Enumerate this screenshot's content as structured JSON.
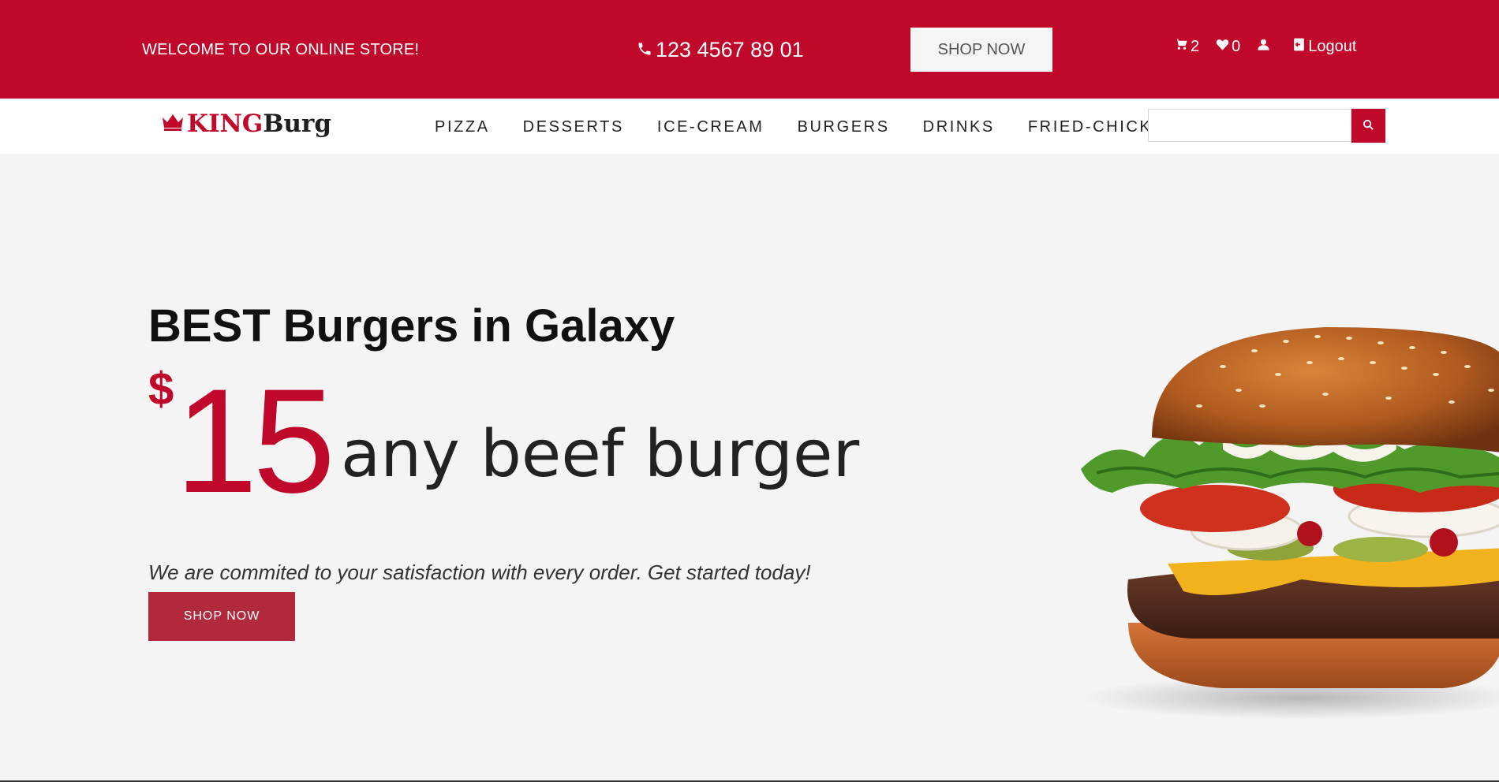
{
  "topbar": {
    "welcome": "WELCOME TO OUR ONLINE STORE!",
    "phone": "123 4567 89 01",
    "shop_now": "SHOP NOW",
    "cart_count": "2",
    "wishlist_count": "0",
    "logout": "Logout"
  },
  "brand": {
    "name_part1": "KING",
    "name_part2": "Burg"
  },
  "nav": {
    "items": [
      "PIZZA",
      "DESSERTS",
      "ICE-CREAM",
      "BURGERS",
      "DRINKS",
      "FRIED-CHICKEN"
    ]
  },
  "search": {
    "value": "",
    "placeholder": ""
  },
  "hero": {
    "title": "BEST Burgers in Galaxy",
    "currency": "$",
    "price": "15",
    "price_desc": "any beef burger",
    "tagline": "We are commited to your satisfaction with every order. Get started today!",
    "cta": "SHOP NOW"
  },
  "icons": {
    "phone": "phone-icon",
    "cart": "cart-icon",
    "wishlist": "wishlist-icon",
    "user": "user-icon",
    "logout": "logout-icon",
    "crown": "crown-icon",
    "search": "search-icon"
  },
  "colors": {
    "brand_red": "#c0092a",
    "cta_red": "#b2293c",
    "hero_bg": "#f4f4f4"
  }
}
